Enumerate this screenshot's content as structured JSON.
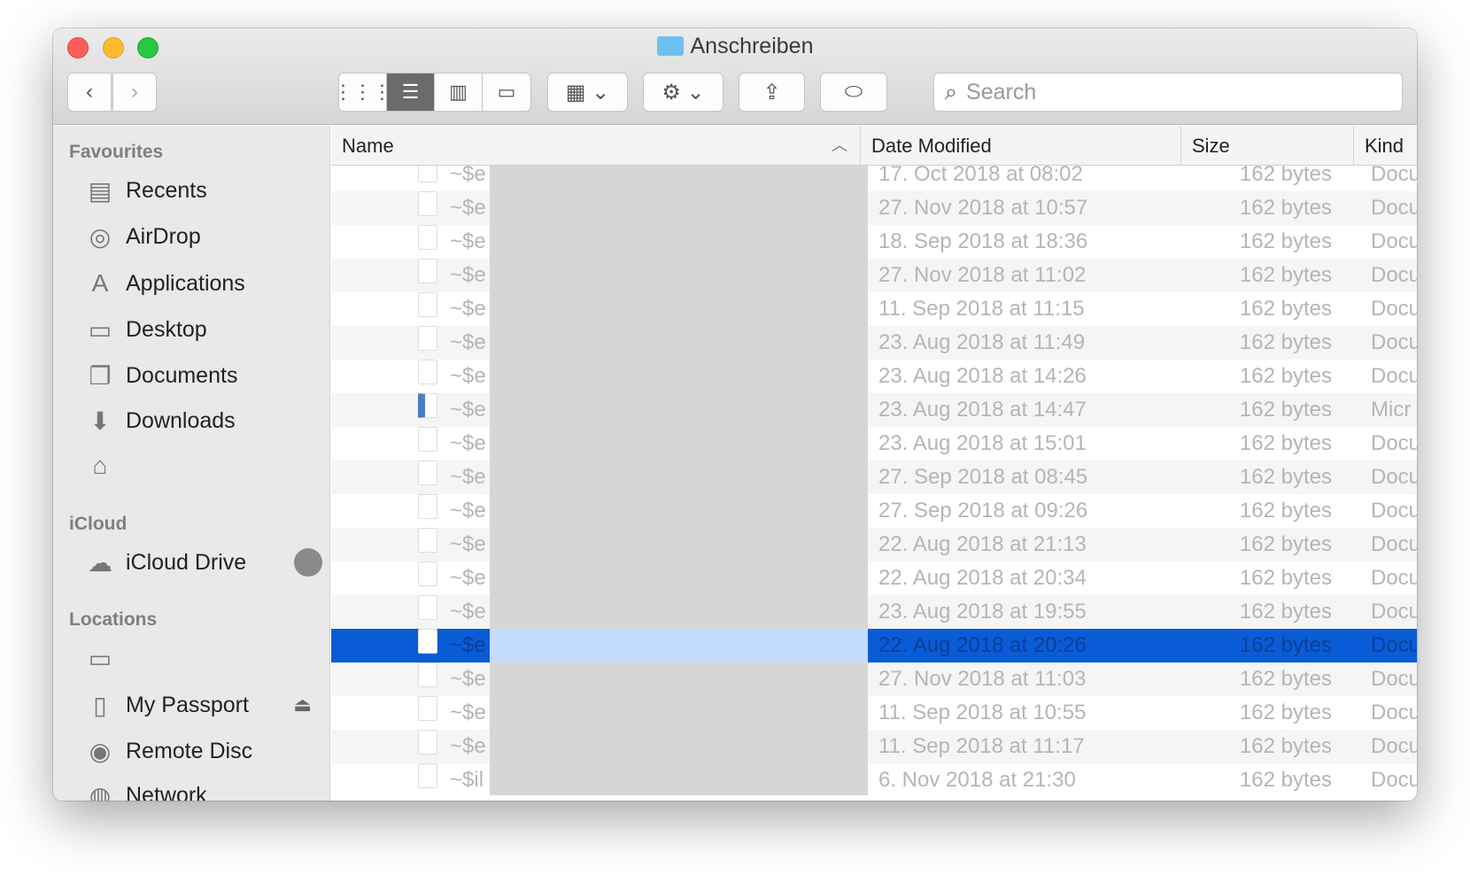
{
  "window": {
    "title": "Anschreiben"
  },
  "toolbar": {
    "search_placeholder": "Search"
  },
  "sidebar": {
    "favourites_header": "Favourites",
    "favourites": [
      {
        "label": "Recents",
        "icon": "recents-icon"
      },
      {
        "label": "AirDrop",
        "icon": "airdrop-icon"
      },
      {
        "label": "Applications",
        "icon": "applications-icon"
      },
      {
        "label": "Desktop",
        "icon": "desktop-icon"
      },
      {
        "label": "Documents",
        "icon": "documents-icon"
      },
      {
        "label": "Downloads",
        "icon": "downloads-icon"
      },
      {
        "label": "",
        "icon": "home-icon"
      }
    ],
    "icloud_header": "iCloud",
    "icloud_drive": "iCloud Drive",
    "locations_header": "Locations",
    "locations": [
      {
        "label": "",
        "icon": "laptop-icon"
      },
      {
        "label": "My Passport",
        "icon": "drive-icon"
      },
      {
        "label": "Remote Disc",
        "icon": "disc-icon"
      },
      {
        "label": "Network",
        "icon": "network-icon"
      }
    ]
  },
  "columns": {
    "name": "Name",
    "date": "Date Modified",
    "size": "Size",
    "kind": "Kind"
  },
  "selected_index": 14,
  "rows": [
    {
      "name": "~$e",
      "date": "17. Oct 2018 at 08:02",
      "size": "162 bytes",
      "kind": "Docu"
    },
    {
      "name": "~$e",
      "date": "27. Nov 2018 at 10:57",
      "size": "162 bytes",
      "kind": "Docu"
    },
    {
      "name": "~$e",
      "date": "18. Sep 2018 at 18:36",
      "size": "162 bytes",
      "kind": "Docu"
    },
    {
      "name": "~$e",
      "date": "27. Nov 2018 at 11:02",
      "size": "162 bytes",
      "kind": "Docu"
    },
    {
      "name": "~$e",
      "date": "11. Sep 2018 at 11:15",
      "size": "162 bytes",
      "kind": "Docu"
    },
    {
      "name": "~$e",
      "date": "23. Aug 2018 at 11:49",
      "size": "162 bytes",
      "kind": "Docu"
    },
    {
      "name": "~$e",
      "date": "23. Aug 2018 at 14:26",
      "size": "162 bytes",
      "kind": "Docu"
    },
    {
      "name": "~$e",
      "date": "23. Aug 2018 at 14:47",
      "size": "162 bytes",
      "kind": "Micr"
    },
    {
      "name": "~$e",
      "date": "23. Aug 2018 at 15:01",
      "size": "162 bytes",
      "kind": "Docu"
    },
    {
      "name": "~$e",
      "date": "27. Sep 2018 at 08:45",
      "size": "162 bytes",
      "kind": "Docu"
    },
    {
      "name": "~$e",
      "date": "27. Sep 2018 at 09:26",
      "size": "162 bytes",
      "kind": "Docu"
    },
    {
      "name": "~$e",
      "date": "22. Aug 2018 at 21:13",
      "size": "162 bytes",
      "kind": "Docu"
    },
    {
      "name": "~$e",
      "date": "22. Aug 2018 at 20:34",
      "size": "162 bytes",
      "kind": "Docu"
    },
    {
      "name": "~$e",
      "date": "23. Aug 2018 at 19:55",
      "size": "162 bytes",
      "kind": "Docu"
    },
    {
      "name": "~$e",
      "date": "22. Aug 2018 at 20:26",
      "size": "162 bytes",
      "kind": "Docu"
    },
    {
      "name": "~$e",
      "date": "27. Nov 2018 at 11:03",
      "size": "162 bytes",
      "kind": "Docu"
    },
    {
      "name": "~$e",
      "date": "11. Sep 2018 at 10:55",
      "size": "162 bytes",
      "kind": "Docu"
    },
    {
      "name": "~$e",
      "date": "11. Sep 2018 at 11:17",
      "size": "162 bytes",
      "kind": "Docu"
    },
    {
      "name": "~$il",
      "date": "6. Nov 2018 at 21:30",
      "size": "162 bytes",
      "kind": "Docu"
    }
  ]
}
